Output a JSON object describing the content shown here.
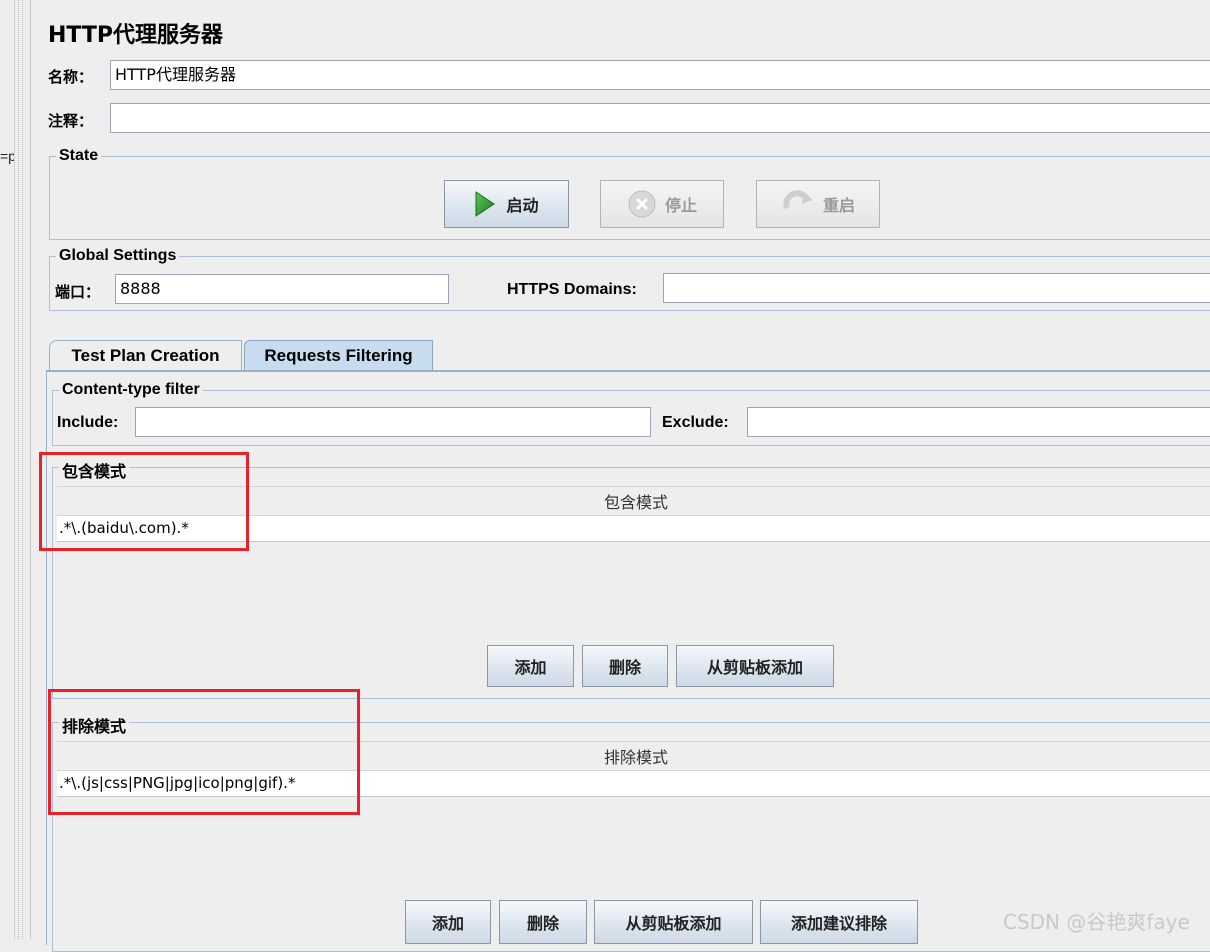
{
  "gutter_label": "=p",
  "title": "HTTP代理服务器",
  "name_label": "名称：",
  "name_value": "HTTP代理服务器",
  "comment_label": "注释：",
  "comment_value": "",
  "state": {
    "legend": "State",
    "start_label": "启动",
    "stop_label": "停止",
    "restart_label": "重启"
  },
  "global": {
    "legend": "Global Settings",
    "port_label": "端口：",
    "port_value": "8888",
    "https_label": "HTTPS Domains:",
    "https_value": ""
  },
  "tabs": [
    {
      "label": "Test Plan Creation",
      "selected": false
    },
    {
      "label": "Requests Filtering",
      "selected": true
    }
  ],
  "content_filter": {
    "legend": "Content-type filter",
    "include_label": "Include:",
    "include_value": "",
    "exclude_label": "Exclude:",
    "exclude_value": ""
  },
  "include_patterns": {
    "legend": "包含模式",
    "column_header": "包含模式",
    "rows": [
      ".*\\.(baidu\\.com).*"
    ],
    "buttons": {
      "add": "添加",
      "delete": "删除",
      "add_clipboard": "从剪贴板添加"
    }
  },
  "exclude_patterns": {
    "legend": "排除模式",
    "column_header": "排除模式",
    "rows": [
      ".*\\.(js|css|PNG|jpg|ico|png|gif).*"
    ],
    "buttons": {
      "add": "添加",
      "delete": "删除",
      "add_clipboard": "从剪贴板添加",
      "add_suggested": "添加建议排除"
    }
  },
  "watermark": "CSDN @谷艳爽faye",
  "colors": {
    "highlight_box": "#e8212a",
    "start_icon": "#2e9a2e",
    "selected_tab": "#c8dcf0"
  }
}
